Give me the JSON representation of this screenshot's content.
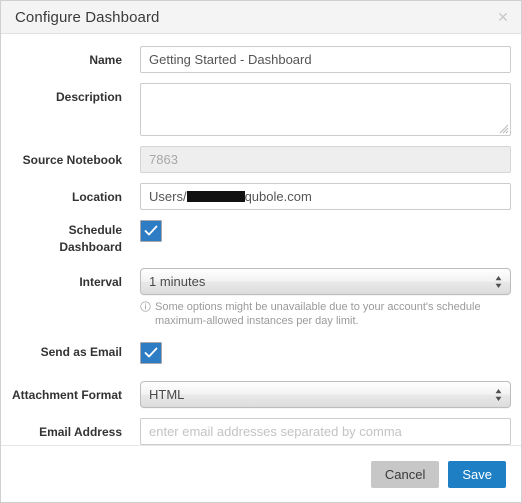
{
  "dialog": {
    "title": "Configure Dashboard",
    "close_icon": "close-icon"
  },
  "form": {
    "name": {
      "label": "Name",
      "value": "Getting Started - Dashboard",
      "placeholder": ""
    },
    "description": {
      "label": "Description",
      "value": "",
      "placeholder": ""
    },
    "source_notebook": {
      "label": "Source Notebook",
      "value": "7863",
      "disabled": true
    },
    "location": {
      "label": "Location",
      "prefix": "Users/",
      "redacted": true,
      "suffix": "qubole.com"
    },
    "schedule_dashboard": {
      "label_line1": "Schedule",
      "label_line2": "Dashboard",
      "checked": true
    },
    "interval": {
      "label": "Interval",
      "selected": "1 minutes",
      "options": [
        "1 minutes"
      ]
    },
    "interval_note": "Some options might be unavailable due to your account's schedule maximum-allowed instances per day limit.",
    "send_as_email": {
      "label": "Send as Email",
      "checked": true
    },
    "attachment_format": {
      "label": "Attachment Format",
      "selected": "HTML",
      "options": [
        "HTML"
      ]
    },
    "email_address": {
      "label": "Email Address",
      "value": "",
      "placeholder": "enter email addresses separated by comma"
    }
  },
  "footer": {
    "cancel_label": "Cancel",
    "save_label": "Save"
  },
  "colors": {
    "accent": "#1f7fc4",
    "checkbox": "#2e7cc4",
    "cancel": "#c7c7c7",
    "header_bg": "#f4f4f4"
  }
}
